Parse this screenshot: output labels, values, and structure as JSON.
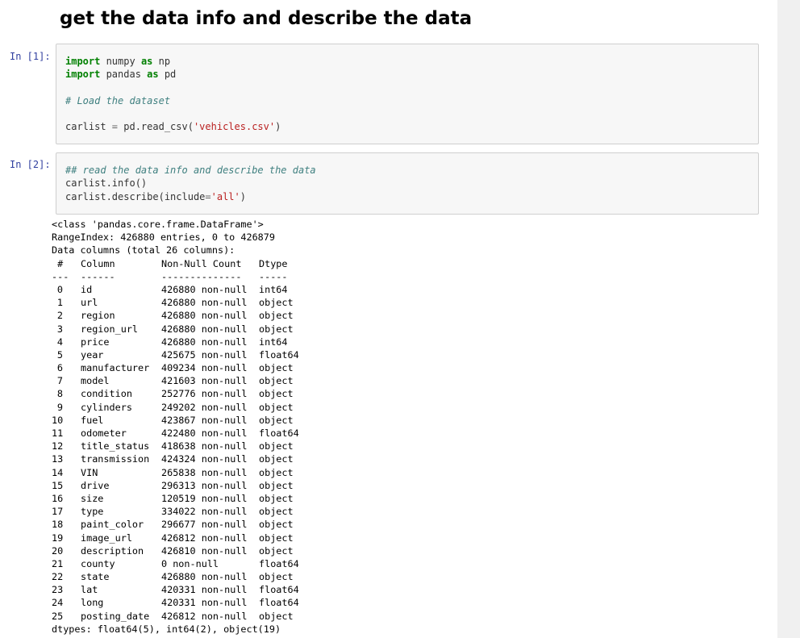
{
  "heading": "get the data info and describe the data",
  "cells": [
    {
      "prompt": "In [1]:",
      "code_lines": [
        [
          [
            "kw",
            "import"
          ],
          [
            "",
            " numpy "
          ],
          [
            "kw",
            "as"
          ],
          [
            "",
            " np"
          ]
        ],
        [
          [
            "kw",
            "import"
          ],
          [
            "",
            " pandas "
          ],
          [
            "kw",
            "as"
          ],
          [
            "",
            " pd"
          ]
        ],
        [],
        [
          [
            "cm",
            "# Load the dataset"
          ]
        ],
        [],
        [
          [
            "",
            "carlist "
          ],
          [
            "op",
            "="
          ],
          [
            "",
            " pd.read_csv("
          ],
          [
            "st",
            "'vehicles.csv'"
          ],
          [
            "",
            ")"
          ]
        ]
      ]
    },
    {
      "prompt": "In [2]:",
      "code_lines": [
        [
          [
            "cm",
            "## read the data info and describe the data"
          ]
        ],
        [
          [
            "",
            "carlist.info()"
          ]
        ],
        [
          [
            "",
            "carlist.describe(include"
          ],
          [
            "op",
            "="
          ],
          [
            "st",
            "'all'"
          ],
          [
            "",
            ")"
          ]
        ]
      ]
    }
  ],
  "output": {
    "header_lines": [
      "<class 'pandas.core.frame.DataFrame'>",
      "RangeIndex: 426880 entries, 0 to 426879",
      "Data columns (total 26 columns):"
    ],
    "table_header": {
      "num": " #",
      "col": "Column",
      "count": "Non-Null Count",
      "dtype": "Dtype"
    },
    "table_sep": {
      "num": "---",
      "col": "------",
      "count": "--------------",
      "dtype": "-----"
    },
    "rows": [
      {
        "num": "0",
        "col": "id",
        "count": "426880 non-null",
        "dtype": "int64"
      },
      {
        "num": "1",
        "col": "url",
        "count": "426880 non-null",
        "dtype": "object"
      },
      {
        "num": "2",
        "col": "region",
        "count": "426880 non-null",
        "dtype": "object"
      },
      {
        "num": "3",
        "col": "region_url",
        "count": "426880 non-null",
        "dtype": "object"
      },
      {
        "num": "4",
        "col": "price",
        "count": "426880 non-null",
        "dtype": "int64"
      },
      {
        "num": "5",
        "col": "year",
        "count": "425675 non-null",
        "dtype": "float64"
      },
      {
        "num": "6",
        "col": "manufacturer",
        "count": "409234 non-null",
        "dtype": "object"
      },
      {
        "num": "7",
        "col": "model",
        "count": "421603 non-null",
        "dtype": "object"
      },
      {
        "num": "8",
        "col": "condition",
        "count": "252776 non-null",
        "dtype": "object"
      },
      {
        "num": "9",
        "col": "cylinders",
        "count": "249202 non-null",
        "dtype": "object"
      },
      {
        "num": "10",
        "col": "fuel",
        "count": "423867 non-null",
        "dtype": "object"
      },
      {
        "num": "11",
        "col": "odometer",
        "count": "422480 non-null",
        "dtype": "float64"
      },
      {
        "num": "12",
        "col": "title_status",
        "count": "418638 non-null",
        "dtype": "object"
      },
      {
        "num": "13",
        "col": "transmission",
        "count": "424324 non-null",
        "dtype": "object"
      },
      {
        "num": "14",
        "col": "VIN",
        "count": "265838 non-null",
        "dtype": "object"
      },
      {
        "num": "15",
        "col": "drive",
        "count": "296313 non-null",
        "dtype": "object"
      },
      {
        "num": "16",
        "col": "size",
        "count": "120519 non-null",
        "dtype": "object"
      },
      {
        "num": "17",
        "col": "type",
        "count": "334022 non-null",
        "dtype": "object"
      },
      {
        "num": "18",
        "col": "paint_color",
        "count": "296677 non-null",
        "dtype": "object"
      },
      {
        "num": "19",
        "col": "image_url",
        "count": "426812 non-null",
        "dtype": "object"
      },
      {
        "num": "20",
        "col": "description",
        "count": "426810 non-null",
        "dtype": "object"
      },
      {
        "num": "21",
        "col": "county",
        "count": "0 non-null",
        "dtype": "float64"
      },
      {
        "num": "22",
        "col": "state",
        "count": "426880 non-null",
        "dtype": "object"
      },
      {
        "num": "23",
        "col": "lat",
        "count": "420331 non-null",
        "dtype": "float64"
      },
      {
        "num": "24",
        "col": "long",
        "count": "420331 non-null",
        "dtype": "float64"
      },
      {
        "num": "25",
        "col": "posting_date",
        "count": "426812 non-null",
        "dtype": "object"
      }
    ],
    "footer_line": "dtypes: float64(5), int64(2), object(19)"
  }
}
